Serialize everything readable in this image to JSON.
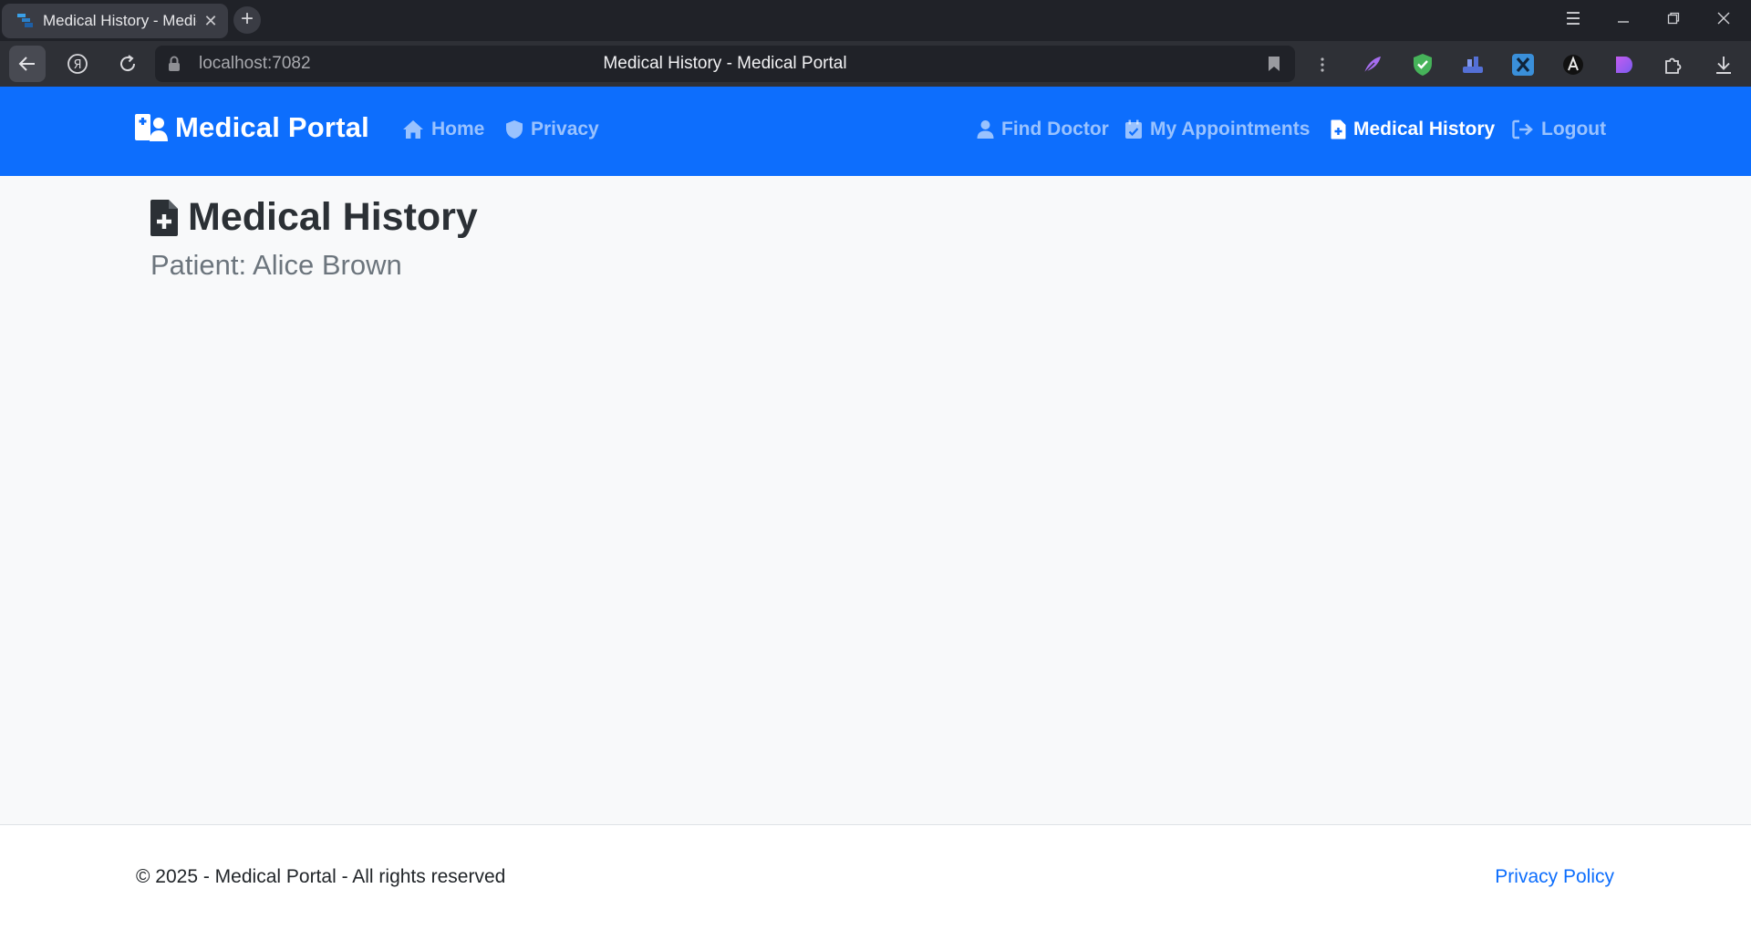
{
  "browser": {
    "tab_title": "Medical History - Medic",
    "new_tab_label": "+",
    "url": "localhost:7082",
    "page_title": "Medical History - Medical Portal"
  },
  "navbar": {
    "brand": "Medical Portal",
    "left_links": [
      {
        "label": "Home",
        "icon": "home-icon"
      },
      {
        "label": "Privacy",
        "icon": "shield-icon"
      }
    ],
    "right_links": [
      {
        "label": "Find Doctor",
        "icon": "user-doctor-icon"
      },
      {
        "label": "My Appointments",
        "icon": "calendar-check-icon"
      },
      {
        "label": "Medical History",
        "icon": "file-medical-icon",
        "active": true
      },
      {
        "label": "Logout",
        "icon": "logout-icon"
      }
    ]
  },
  "main": {
    "title": "Medical History",
    "patient": "Patient: Alice Brown"
  },
  "footer": {
    "copyright": "© 2025 - Medical Portal - All rights reserved",
    "privacy_link": "Privacy Policy"
  },
  "colors": {
    "navbar": "#0d6efd",
    "page_bg": "#f8f9fa",
    "link": "#0d6efd"
  }
}
